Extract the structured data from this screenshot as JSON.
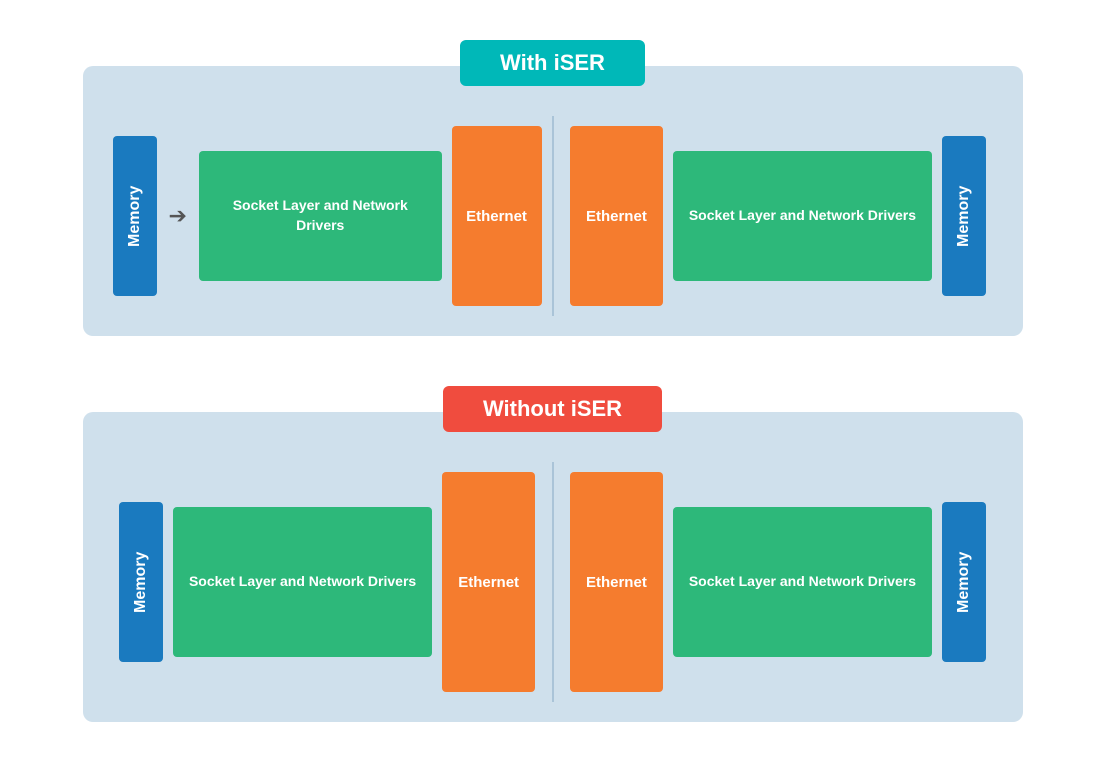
{
  "diagrams": [
    {
      "id": "iser",
      "title": "With iSER",
      "titleClass": "title-iser",
      "left": {
        "memory": "Memory",
        "socket": "Socket Layer and Network Drivers",
        "ethernet": "Ethernet",
        "showArrow": true
      },
      "right": {
        "ethernet": "Ethernet",
        "socket": "Socket Layer and Network Drivers",
        "memory": "Memory"
      }
    },
    {
      "id": "no-iser",
      "title": "Without iSER",
      "titleClass": "title-no-iser",
      "left": {
        "memory": "Memory",
        "socket": "Socket Layer and Network Drivers",
        "ethernet": "Ethernet",
        "showArrow": false
      },
      "right": {
        "ethernet": "Ethernet",
        "socket": "Socket Layer and Network Drivers",
        "memory": "Memory"
      }
    }
  ]
}
